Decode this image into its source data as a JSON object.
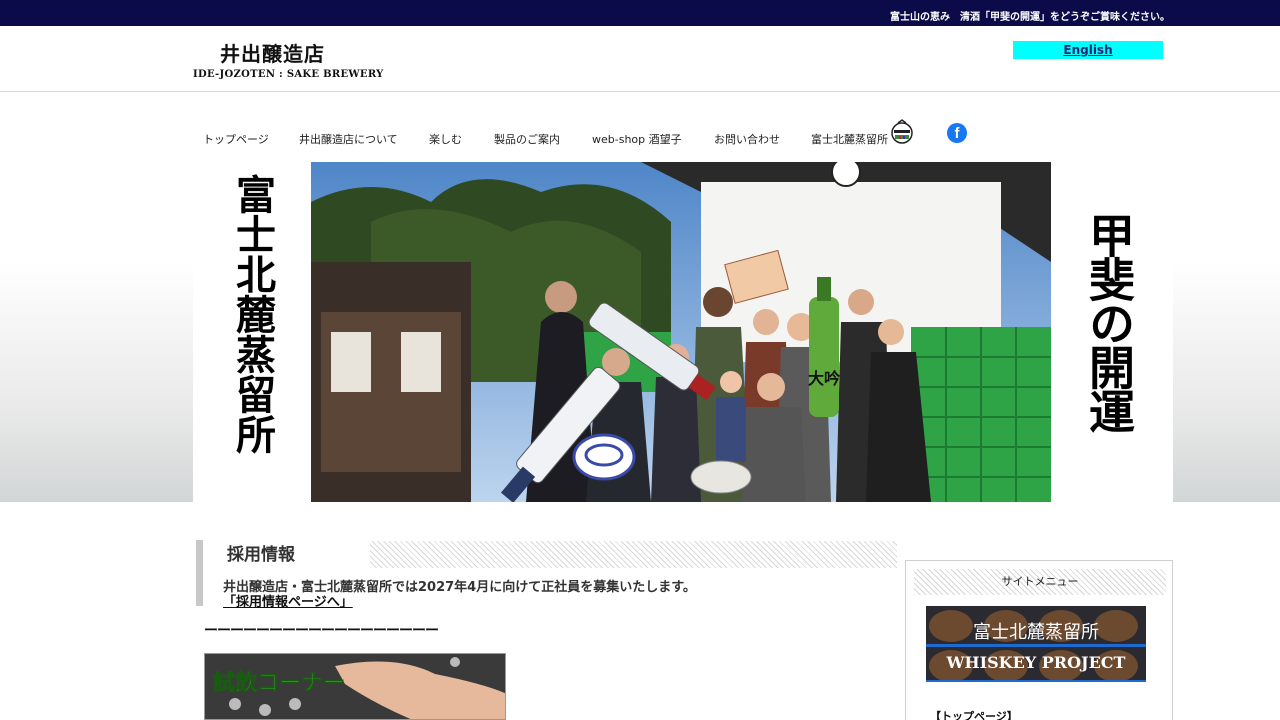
{
  "topbar": {
    "tagline": "富士山の恵み　清酒「甲斐の開運」をどうぞご賞味ください。"
  },
  "header": {
    "logo_jp": "井出醸造店",
    "logo_en": "IDE-JOZOTEN : SAKE BREWERY",
    "english_label": "English"
  },
  "nav": {
    "items": [
      {
        "label": "トップページ"
      },
      {
        "label": "井出醸造店について"
      },
      {
        "label": "楽しむ"
      },
      {
        "label": "製品のご案内"
      },
      {
        "label": "web-shop 酒望子"
      },
      {
        "label": "お問い合わせ"
      },
      {
        "label": "富士北麓蒸留所"
      }
    ]
  },
  "hero": {
    "left_text": "富士北麓蒸留所",
    "right_text": "甲斐の開運",
    "sign_text": "大吟"
  },
  "recruit": {
    "title": "採用情報",
    "text": "井出醸造店・富士北麓蒸留所では2027年4月に向けて正社員を募集いたします。",
    "link": "「採用情報ページへ」"
  },
  "divider": "ーーーーーーーーーーーーーーーーーー",
  "tasting": {
    "label": "試飲コーナー"
  },
  "sidebar": {
    "title": "サイトメニュー",
    "whiskey_line1": "富士北麓蒸留所",
    "whiskey_line2": "WHISKEY PROJECT",
    "first_item": "【トップページ】"
  },
  "colors": {
    "topbar": "#0b0b4a",
    "english_button": "#00ffff",
    "facebook": "#1877f2"
  }
}
